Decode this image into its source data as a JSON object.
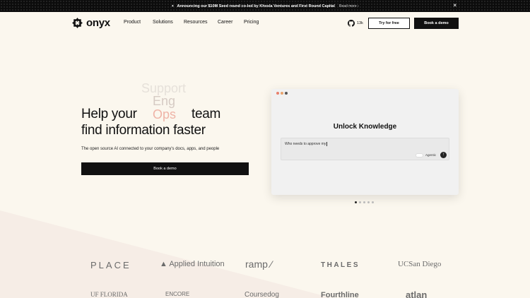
{
  "announcement": {
    "text": "Announcing our $10M Seed round co-led by Khosla Ventures and First Round Capital",
    "link": "Read more",
    "spark_icon": "sparkle-icon",
    "close_icon": "close-icon"
  },
  "nav": {
    "brand": "onyx",
    "menu": [
      "Product",
      "Solutions",
      "Resources",
      "Career",
      "Pricing"
    ],
    "github_stars": "13k",
    "try_label": "Try for free",
    "demo_label": "Book a demo"
  },
  "hero": {
    "rotating_words": [
      "Support",
      "Eng",
      "Ops"
    ],
    "line1_prefix": "Help your",
    "line1_suffix": "team",
    "line2": "find information faster",
    "subtitle": "The open source AI connected to your company's docs, apps, and people",
    "cta": "Book a demo"
  },
  "demo_window": {
    "title": "Unlock Knowledge",
    "query": "Who needs to approve my",
    "toggle_label": "Agentic",
    "send_icon": "arrow-up-icon",
    "pages": 5,
    "active_page": 1
  },
  "logos": {
    "row1": [
      "PLACE",
      "Applied Intuition",
      "ramp",
      "THALES",
      "UCSan Diego"
    ],
    "row2": [
      "UF FLORIDA",
      "ENCORE",
      "Coursedog",
      "Fourthline",
      "atlan"
    ]
  },
  "colors": {
    "background": "#fbf7ee",
    "accent": "#efb4a7",
    "dark": "#111111"
  }
}
